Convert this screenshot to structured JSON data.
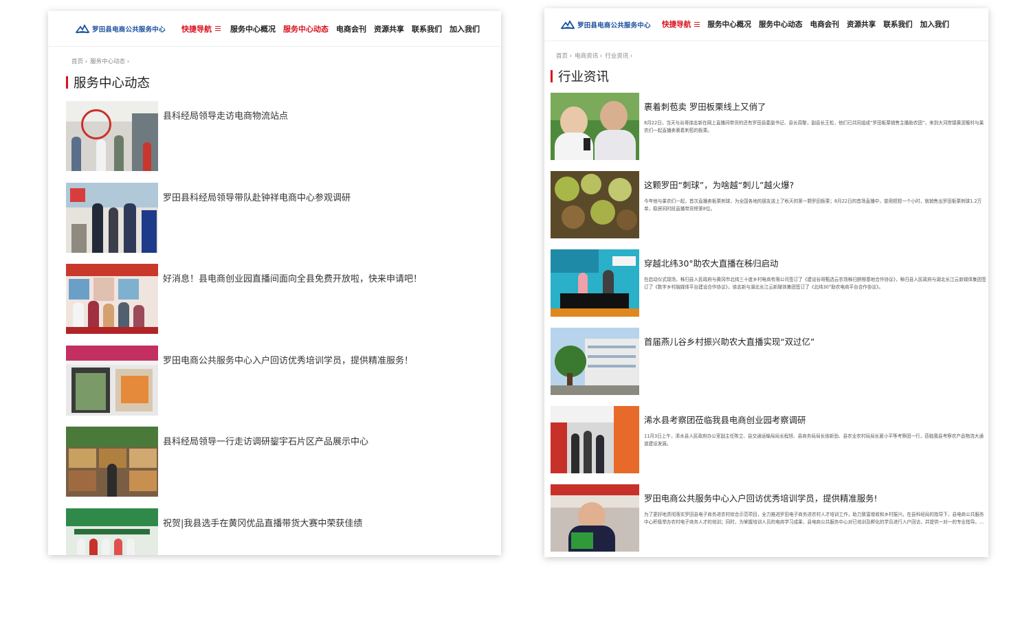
{
  "brand": {
    "name": "罗田县电商公共服务中心"
  },
  "nav": {
    "quick": "快捷导航",
    "items": [
      "服务中心概况",
      "服务中心动态",
      "电商会刊",
      "资源共享",
      "联系我们",
      "加入我们"
    ]
  },
  "left": {
    "active_index": 1,
    "breadcrumb": [
      "首页 ›",
      "服务中心动态 ›"
    ],
    "title": "服务中心动态",
    "items": [
      {
        "title": "县科经局领导走访电商物流站点"
      },
      {
        "title": "罗田县科经局领导带队赴钟祥电商中心参观调研"
      },
      {
        "title": "好消息！县电商创业园直播间面向全县免费开放啦，快来申请吧！"
      },
      {
        "title": "罗田电商公共服务中心入户回访优秀培训学员，提供精准服务！"
      },
      {
        "title": "县科经局领导一行走访调研鋆宇石片区产品展示中心"
      },
      {
        "title": "祝贺|我县选手在黄冈优品直播带货大赛中荣获佳绩"
      }
    ]
  },
  "right": {
    "active_index": -1,
    "breadcrumb": [
      "首页 ›",
      "电商资讯 ›",
      "行业资讯 ›"
    ],
    "title": "行业资讯",
    "items": [
      {
        "title": "裹着刺苞卖 罗田板栗线上又俏了",
        "excerpt": "8月22日，当天与谷哥徐志新在网上直播间带货的还有罗田县委副书记、县长周黎，副县长王松，他们已共同组成“罗田板栗销售主播助农团”，来到大河岸镇黄泥畈村与果农们一起直播卖裹着刺苞的板栗。"
      },
      {
        "title": "这颗罗田“刺球”，为啥越“刺儿”越火爆?",
        "excerpt": "今年他与果农们一起，首次直播卖板栗刺球，为全国各地的朋友送上了秋天的第一颗罗田板栗；8月22日的首场直播中，曾用短短一个小时，就销售出罗田板栗刺球1.2万单，稳居同时段直播带货榜第8位。"
      },
      {
        "title": "穿越北纬30°助农大直播在秭归启动",
        "excerpt": "在启动仪式现场，秭归县人民政府与黄冈市北纬三十度乡村电商有限公司签订了《建设谷哥甄选云农场秭归脐橙基地合作协议》，秭归县人民政府与湖北长江云新媒体集团签订了《数字乡村融媒体平台建设合作协议》，徐志新与湖北长江云新媒体集团签订了《北纬30°助农电商平台合作协议》。"
      },
      {
        "title": "首届燕儿谷乡村振兴助农大直播实现“双过亿”",
        "excerpt": ""
      },
      {
        "title": "浠水县考察团莅临我县电商创业园考察调研",
        "excerpt": "11月3日上午，浠水县人民政府办公室副主任陈立、县交通运输局局长程旭、县商务局局长徐新劲、县农业农村局局长夏小平等考察团一行，莅临我县考察农产品物流大通道建设发展。"
      },
      {
        "title": "罗田电商公共服务中心入户回访优秀培训学员，提供精准服务!",
        "excerpt": "为了更好地贯彻落实罗田县电子商务进农村综合示范项目，全力推进罗田电子商务进农村人才培训工作，助力致富增收和乡村振兴。在县科经局的指导下，县电商公共服务中心积极举办农村电子商务人才的培训；同时，为掌握培训人员的电商学习成果，县电商公共服务中心对已培训及孵化的学员进行入户回访，并提供一对一的专业指导。..."
      }
    ]
  },
  "colors": {
    "accent": "#d9121f",
    "brand": "#1a4f9c"
  }
}
